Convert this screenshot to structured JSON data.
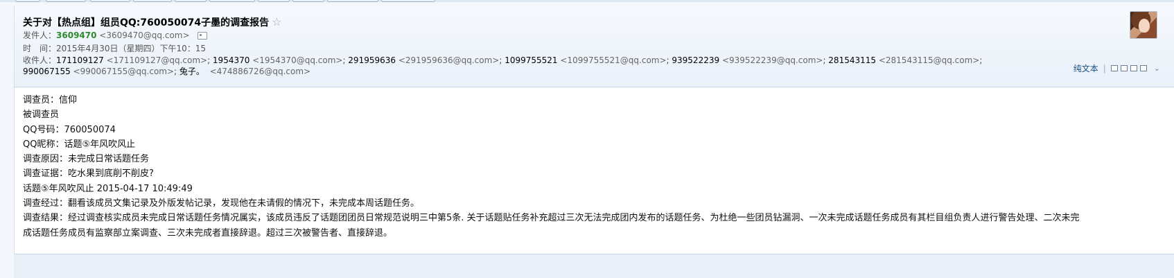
{
  "subject": {
    "text": "关于对【热点组】组员QQ:760050074子墨的调查报告",
    "star_icon": "star-icon"
  },
  "sender": {
    "label": "发件人：",
    "name": "3609470",
    "address": "<3609470@qq.com>",
    "contact_icon": "contact-card-icon"
  },
  "time": {
    "label": "时　间：",
    "value": "2015年4月30日（星期四）下午10：15"
  },
  "recipients": {
    "label": "收件人：",
    "list": [
      {
        "name": "171109127",
        "address": "<171109127@qq.com>"
      },
      {
        "name": "1954370",
        "address": "<1954370@qq.com>"
      },
      {
        "name": "291959636",
        "address": "<291959636@qq.com>"
      },
      {
        "name": "1099755521",
        "address": "<1099755521@qq.com>"
      },
      {
        "name": "939522239",
        "address": "<939522239@qq.com>"
      },
      {
        "name": "281543115",
        "address": "<281543115@qq.com>"
      },
      {
        "name": "990067155",
        "address": "<990067155@qq.com>"
      },
      {
        "name": "兔子。",
        "address": "<474886726@qq.com>"
      }
    ]
  },
  "toolbar": {
    "plain_text": "纯文本",
    "icons": [
      "new-window-icon",
      "copy-icon",
      "save-icon",
      "print-icon",
      "expand-icon"
    ]
  },
  "body_lines": [
    "调查员：信仰",
    "被调查员",
    "QQ号码：760050074",
    "QQ昵称：话题⑤年风吹风止",
    "调查原因：未完成日常话题任务",
    "调查证据：吃水果到底削不削皮?",
    "话题⑤年风吹风止 2015-04-17 10:49:49",
    "调查经过：翻看该成员文集记录及外版发帖记录，发现他在未请假的情况下，未完成本周话题任务。",
    "调查结果：经过调查核实成员未完成日常话题任务情况属实，该成员违反了话题团团员日常规范说明三中第5条. 关于话题贴任务补充超过三次无法完成团内发布的话题任务、为杜绝一些团员钻漏洞、一次未完成话题任务成员有其栏目组负责人进行警告处理、二次未完成话题任务成员有监察部立案调查、三次未完成者直接辞退。超过三次被警告者、直接辞退。"
  ]
}
